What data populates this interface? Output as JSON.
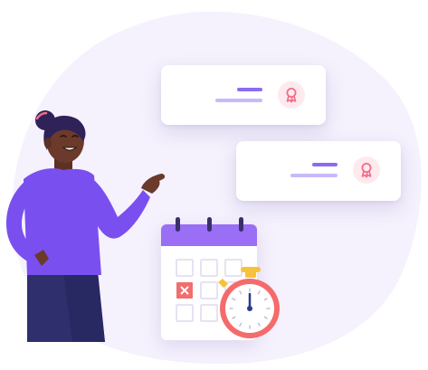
{
  "illustration": {
    "subject": "",
    "colors": {
      "blob": "#f5f1fd",
      "card": "#ffffff",
      "line_primary": "#8b6cf0",
      "line_secondary": "#c9b9fb",
      "badge_bg": "#fde9ee",
      "badge_icon": "#f06e86",
      "calendar_header": "#9a6ef5",
      "calendar_cell_marked": "#f06e6e",
      "stopwatch_ring": "#f46b6b",
      "stopwatch_button": "#f7c23b",
      "shirt": "#7a4ff0",
      "skirt": "#2f2f6e",
      "skin": "#6b3a2a",
      "hair": "#2e2258"
    },
    "cards": [
      {
        "icon": "ribbon-award-icon"
      },
      {
        "icon": "ribbon-award-icon"
      }
    ],
    "calendar": {
      "marked_cell_icon": "x-mark-icon"
    },
    "stopwatch": {
      "icon": "stopwatch-icon"
    }
  }
}
